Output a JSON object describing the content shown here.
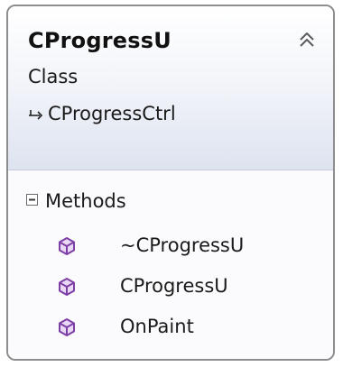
{
  "class_shape": {
    "name": "CProgressU",
    "stereotype": "Class",
    "base_class": "CProgressCtrl",
    "collapse_icon": "double-chevron-up-icon",
    "header_gradient": [
      "#ffffff",
      "#dde3f0"
    ],
    "border_color": "#8d8d8d"
  },
  "methods_section": {
    "title": "Methods",
    "toggle_icon": "collapse-minus-icon",
    "method_icon": "method-cube-icon",
    "method_icon_color": "#7d3fa6",
    "items": [
      {
        "label": "~CProgressU"
      },
      {
        "label": "CProgressU"
      },
      {
        "label": "OnPaint"
      }
    ]
  }
}
